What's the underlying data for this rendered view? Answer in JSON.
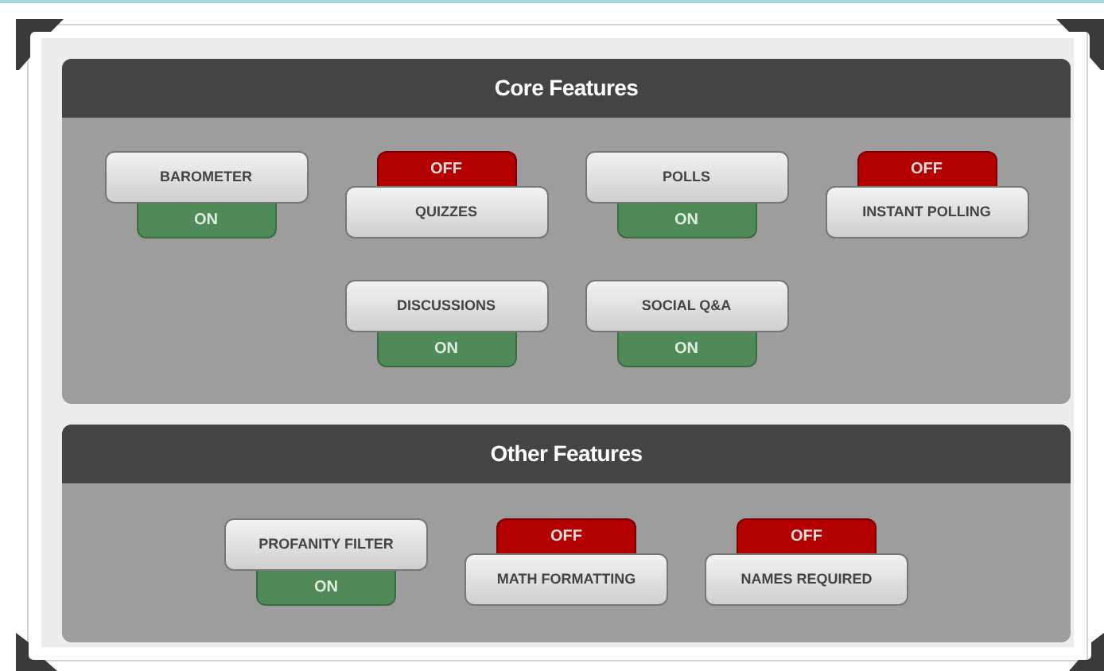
{
  "sections": [
    {
      "title": "Core Features",
      "features": [
        {
          "label": "BAROMETER",
          "status": "ON",
          "on": true
        },
        {
          "label": "QUIZZES",
          "status": "OFF",
          "on": false
        },
        {
          "label": "POLLS",
          "status": "ON",
          "on": true
        },
        {
          "label": "INSTANT POLLING",
          "status": "OFF",
          "on": false
        },
        {
          "label": "DISCUSSIONS",
          "status": "ON",
          "on": true
        },
        {
          "label": "SOCIAL Q&A",
          "status": "ON",
          "on": true
        }
      ]
    },
    {
      "title": "Other Features",
      "features": [
        {
          "label": "PROFANITY FILTER",
          "status": "ON",
          "on": true
        },
        {
          "label": "MATH FORMATTING",
          "status": "OFF",
          "on": false
        },
        {
          "label": "NAMES REQUIRED",
          "status": "OFF",
          "on": false
        }
      ]
    }
  ]
}
